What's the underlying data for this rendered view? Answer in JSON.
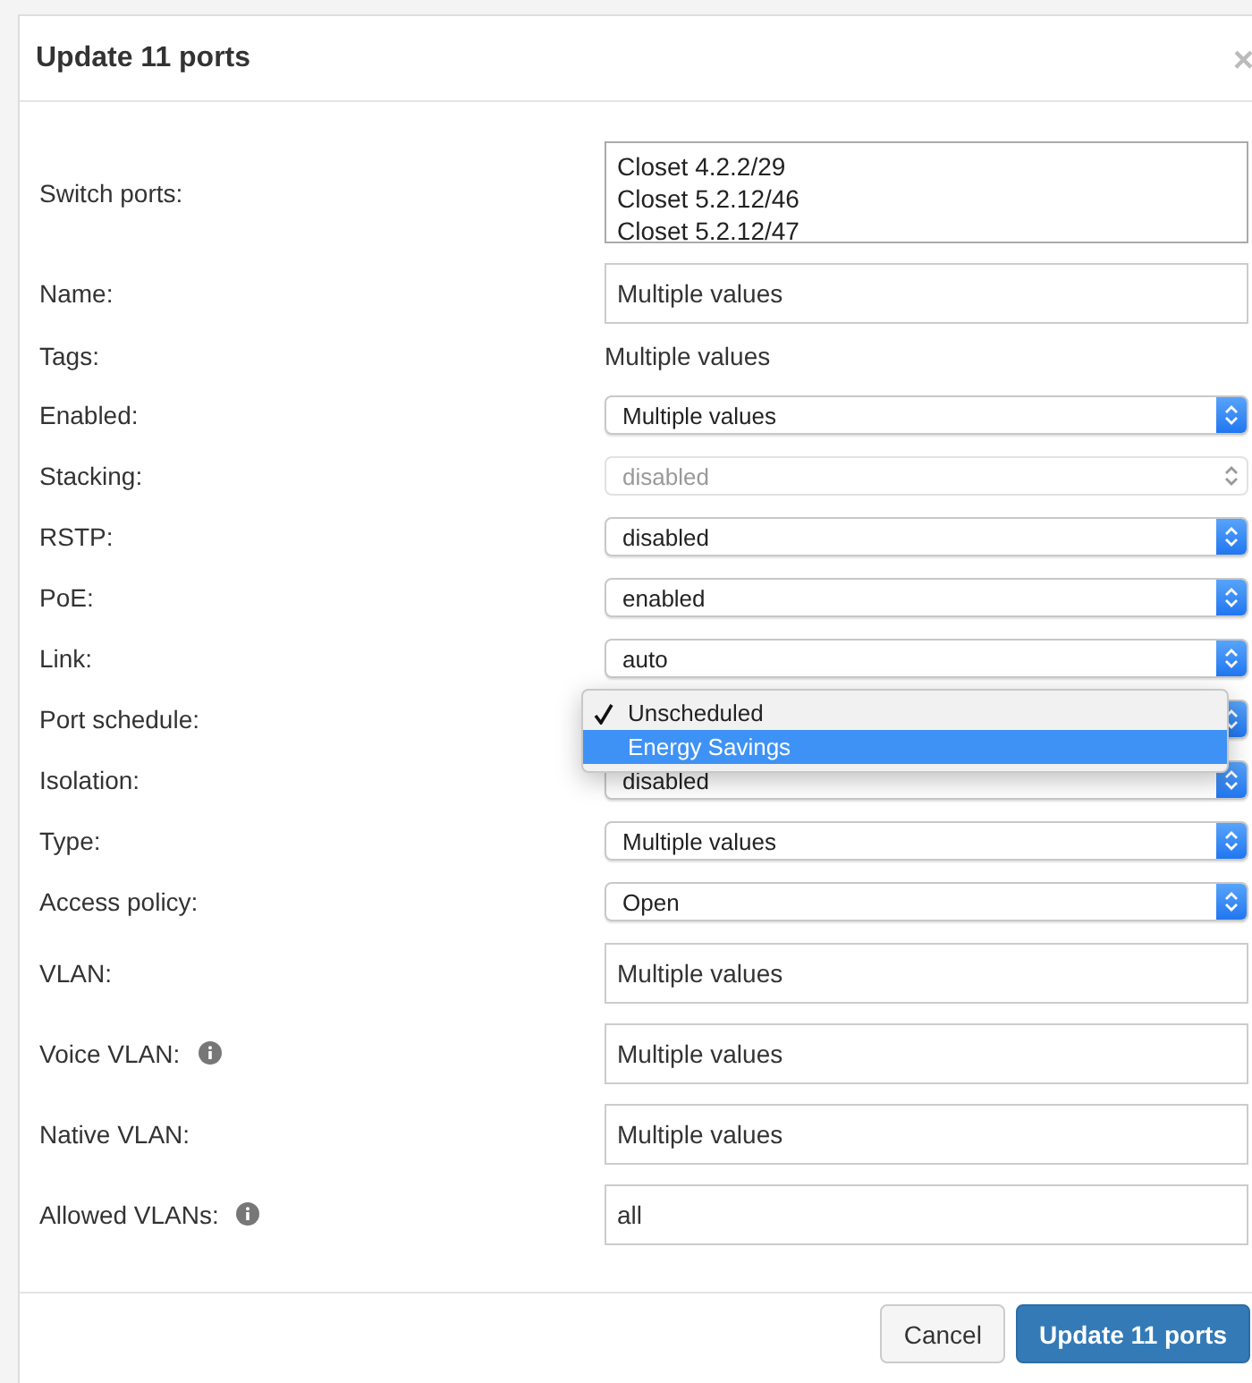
{
  "dialog": {
    "title": "Update 11 ports",
    "close": "×"
  },
  "fields": [
    {
      "label": "Switch ports:",
      "kind": "listbox",
      "items": [
        "Closet 4.2.2/29",
        "Closet 5.2.12/46",
        "Closet 5.2.12/47"
      ]
    },
    {
      "label": "Name:",
      "kind": "input",
      "value": "Multiple values"
    },
    {
      "label": "Tags:",
      "kind": "text",
      "value": "Multiple values"
    },
    {
      "label": "Enabled:",
      "kind": "select",
      "value": "Multiple values",
      "disabled": false
    },
    {
      "label": "Stacking:",
      "kind": "select",
      "value": "disabled",
      "disabled": true
    },
    {
      "label": "RSTP:",
      "kind": "select",
      "value": "disabled",
      "disabled": false
    },
    {
      "label": "PoE:",
      "kind": "select",
      "value": "enabled",
      "disabled": false
    },
    {
      "label": "Link:",
      "kind": "select",
      "value": "auto",
      "disabled": false
    },
    {
      "label": "Port schedule:",
      "kind": "select",
      "disabled": false,
      "open": true,
      "options": [
        {
          "label": "Unscheduled",
          "checked": true,
          "highlighted": false
        },
        {
          "label": "Energy Savings",
          "checked": false,
          "highlighted": true
        }
      ]
    },
    {
      "label": "Isolation:",
      "kind": "select",
      "value": "disabled",
      "disabled": false
    },
    {
      "label": "Type:",
      "kind": "select",
      "value": "Multiple values",
      "disabled": false
    },
    {
      "label": "Access policy:",
      "kind": "select",
      "value": "Open",
      "disabled": false
    },
    {
      "label": "VLAN:",
      "kind": "input",
      "value": "Multiple values"
    },
    {
      "label": "Voice VLAN:",
      "kind": "input",
      "value": "Multiple values",
      "info": true
    },
    {
      "label": "Native VLAN:",
      "kind": "input",
      "value": "Multiple values"
    },
    {
      "label": "Allowed VLANs:",
      "kind": "input",
      "value": "all",
      "info": true
    }
  ],
  "buttons": [
    {
      "label": "Cancel",
      "primary": false
    },
    {
      "label": "Update 11 ports",
      "primary": true
    }
  ]
}
